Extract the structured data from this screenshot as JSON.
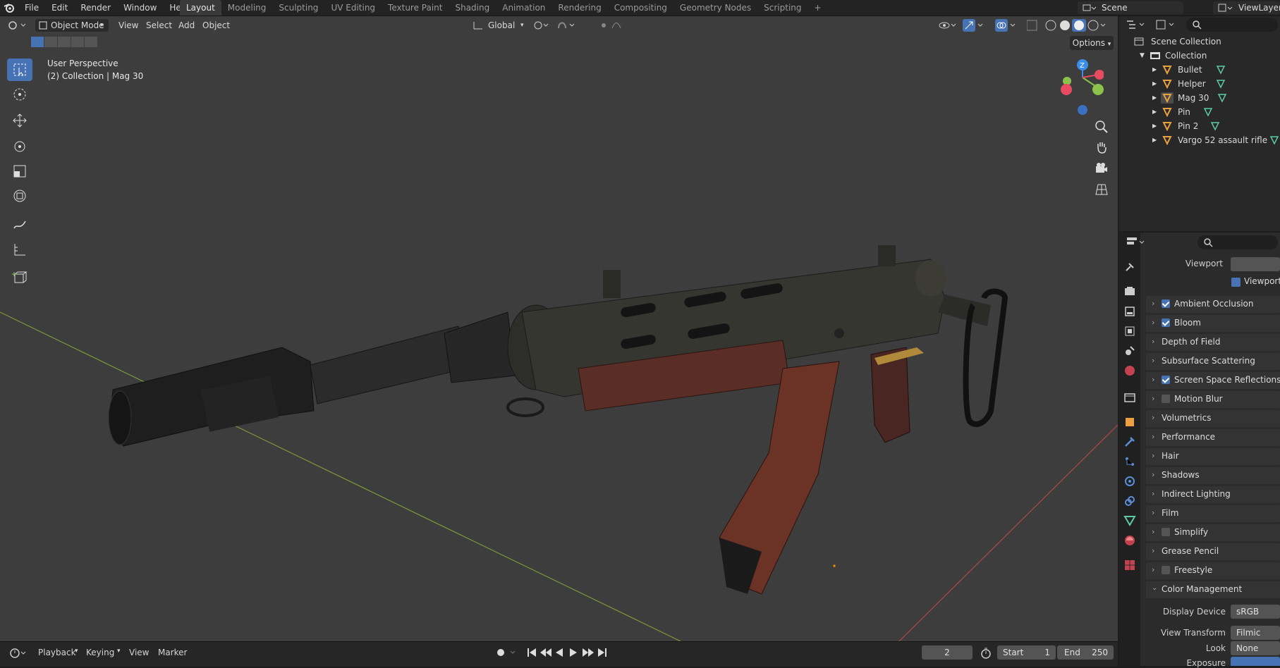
{
  "menubar": {
    "items": [
      "File",
      "Edit",
      "Render",
      "Window",
      "Help"
    ],
    "workspaces": [
      "Layout",
      "Modeling",
      "Sculpting",
      "UV Editing",
      "Texture Paint",
      "Shading",
      "Animation",
      "Rendering",
      "Compositing",
      "Geometry Nodes",
      "Scripting"
    ],
    "active_workspace": "Layout",
    "add_tab": "+",
    "scene": "Scene",
    "view_layer": "ViewLayer"
  },
  "viewport_header": {
    "mode": "Object Mode",
    "menus": [
      "View",
      "Select",
      "Add",
      "Object"
    ],
    "orientation": "Global",
    "options": "Options"
  },
  "viewport": {
    "perspective_label": "User Perspective",
    "collection_label": "(2) Collection | Mag 30"
  },
  "gizmo": {
    "x_color": "#e84a5f",
    "y_color": "#8bc34a",
    "z_color": "#3b8ee8"
  },
  "timeline": {
    "menus": [
      "Playback",
      "Keying",
      "View",
      "Marker"
    ],
    "current_frame": "2",
    "start_label": "Start",
    "start_value": "1",
    "end_label": "End",
    "end_value": "250"
  },
  "outliner": {
    "root": "Scene Collection",
    "collection": "Collection",
    "objects": [
      "Bullet",
      "Helper",
      "Mag 30",
      "Pin",
      "Pin 2",
      "Vargo 52 assault rifle"
    ],
    "selected": "Mag 30"
  },
  "properties": {
    "partial_top": "Viewport",
    "viewport_denoise": "Viewport D",
    "panels": [
      {
        "label": "Ambient Occlusion",
        "checkbox": true,
        "checked": true
      },
      {
        "label": "Bloom",
        "checkbox": true,
        "checked": true
      },
      {
        "label": "Depth of Field",
        "checkbox": false,
        "checked": false
      },
      {
        "label": "Subsurface Scattering",
        "checkbox": false,
        "checked": false
      },
      {
        "label": "Screen Space Reflections",
        "checkbox": true,
        "checked": true
      },
      {
        "label": "Motion Blur",
        "checkbox": true,
        "checked": false
      },
      {
        "label": "Volumetrics",
        "checkbox": false,
        "checked": false
      },
      {
        "label": "Performance",
        "checkbox": false,
        "checked": false
      },
      {
        "label": "Hair",
        "checkbox": false,
        "checked": false
      },
      {
        "label": "Shadows",
        "checkbox": false,
        "checked": false
      },
      {
        "label": "Indirect Lighting",
        "checkbox": false,
        "checked": false
      },
      {
        "label": "Film",
        "checkbox": false,
        "checked": false
      },
      {
        "label": "Simplify",
        "checkbox": true,
        "checked": false
      },
      {
        "label": "Grease Pencil",
        "checkbox": false,
        "checked": false
      },
      {
        "label": "Freestyle",
        "checkbox": true,
        "checked": false
      },
      {
        "label": "Color Management",
        "checkbox": false,
        "checked": false,
        "expanded": true
      }
    ],
    "color_management": {
      "display_device_label": "Display Device",
      "display_device": "sRGB",
      "view_transform_label": "View Transform",
      "view_transform": "Filmic",
      "look_label": "Look",
      "look": "None",
      "exposure_label": "Exposure"
    }
  }
}
